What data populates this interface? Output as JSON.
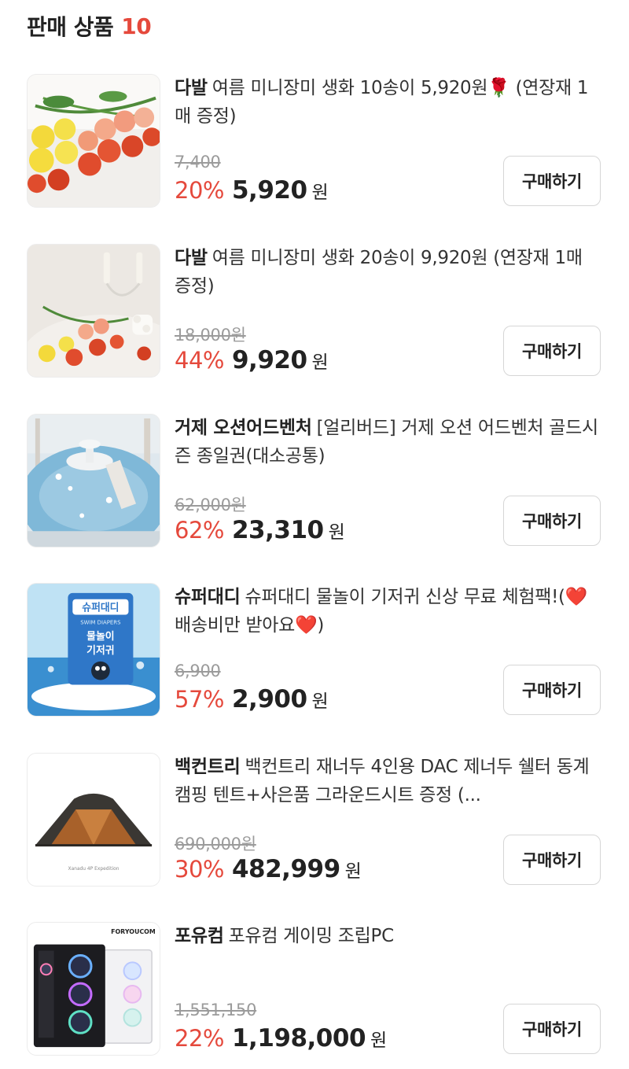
{
  "header": {
    "title": "판매 상품",
    "count": "10"
  },
  "products": [
    {
      "image": "flower-bouquet-image",
      "brand": "다발",
      "title": "여름 미니장미 생화 10송이 5,920원🌹 (연장재 1매 증정)",
      "original_price": "7,400",
      "discount": "20%",
      "price": "5,920",
      "currency": "원",
      "buy_label": "구매하기"
    },
    {
      "image": "flower-vase-image",
      "brand": "다발",
      "title": "여름 미니장미 생화 20송이 9,920원 (연장재 1매 증정)",
      "original_price": "18,000원",
      "discount": "44%",
      "price": "9,920",
      "currency": "원",
      "buy_label": "구매하기"
    },
    {
      "image": "water-park-image",
      "brand": "거제 오션어드벤처",
      "title": "[얼리버드] 거제 오션 어드벤처 골드시즌 종일권(대소공통)",
      "original_price": "62,000원",
      "discount": "62%",
      "price": "23,310",
      "currency": "원",
      "buy_label": "구매하기"
    },
    {
      "image": "swim-diaper-pack-image",
      "brand": "슈퍼대디",
      "title": "슈퍼대디 물놀이 기저귀 신상 무료 체험팩!(❤️배송비만 받아요❤️)",
      "original_price": "6,900",
      "discount": "57%",
      "price": "2,900",
      "currency": "원",
      "buy_label": "구매하기"
    },
    {
      "image": "camping-tent-image",
      "brand": "백컨트리",
      "title": "백컨트리 재너두 4인용 DAC 제너두 쉘터 동계 캠핑 텐트+사은품 그라운드시트 증정 (...",
      "original_price": "690,000원",
      "discount": "30%",
      "price": "482,999",
      "currency": "원",
      "buy_label": "구매하기"
    },
    {
      "image": "gaming-pc-image",
      "brand": "포유컴",
      "title": "포유컴 게이밍 조립PC",
      "original_price": "1,551,150",
      "discount": "22%",
      "price": "1,198,000",
      "currency": "원",
      "buy_label": "구매하기"
    }
  ],
  "image_texts": {
    "diaper_pack": "슈퍼대디",
    "diaper_pack_sub": "SWIM DIAPERS",
    "diaper_pack_name_1": "물놀이",
    "diaper_pack_name_2": "기저귀",
    "tent_caption": "Xanadu 4P Expedition",
    "pc_logo": "FORYOUCOM"
  },
  "colors": {
    "accent": "#e5493c",
    "text": "#222222",
    "strike": "#9b9b9b",
    "border": "#d6d6d6"
  }
}
